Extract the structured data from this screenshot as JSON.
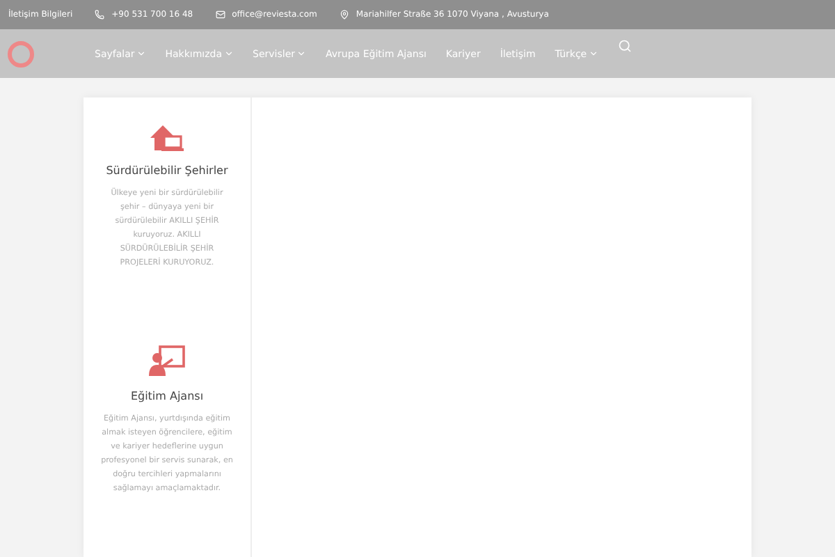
{
  "top_bar": {
    "label": "İletişim Bilgileri",
    "phone": "+90 531 700 16 48",
    "email": "office@reviesta.com",
    "address": "Mariahilfer Straße 36 1070 Viyana , Avusturya"
  },
  "nav": {
    "items": [
      {
        "label": "Sayfalar",
        "dropdown": true
      },
      {
        "label": "Hakkımızda",
        "dropdown": true
      },
      {
        "label": "Servisler",
        "dropdown": true
      },
      {
        "label": "Avrupa Eğitim Ajansı",
        "dropdown": false
      },
      {
        "label": "Kariyer",
        "dropdown": false
      },
      {
        "label": "İletişim",
        "dropdown": false
      },
      {
        "label": "Türkçe",
        "dropdown": true
      }
    ]
  },
  "features": [
    {
      "kind": "city",
      "title": "Sürdürülebilir Şehirler",
      "text": "Ülkeye yeni bir sürdürülebilir şehir – dünyaya yeni bir sürdürülebilir AKILLI ŞEHİR kuruyoruz. AKILLI SÜRDÜRÜLEBİLİR ŞEHİR PROJELERİ KURUYORUZ."
    },
    {
      "kind": "education",
      "title": "Eğitim Ajansı",
      "text": "Eğitim Ajansı, yurtdışında eğitim almak isteyen öğrencilere, eğitim ve kariyer hedeflerine uygun profesyonel bir servis sunarak, en doğru tercihleri yapmalarını sağlamayı amaçlamaktadır."
    }
  ]
}
